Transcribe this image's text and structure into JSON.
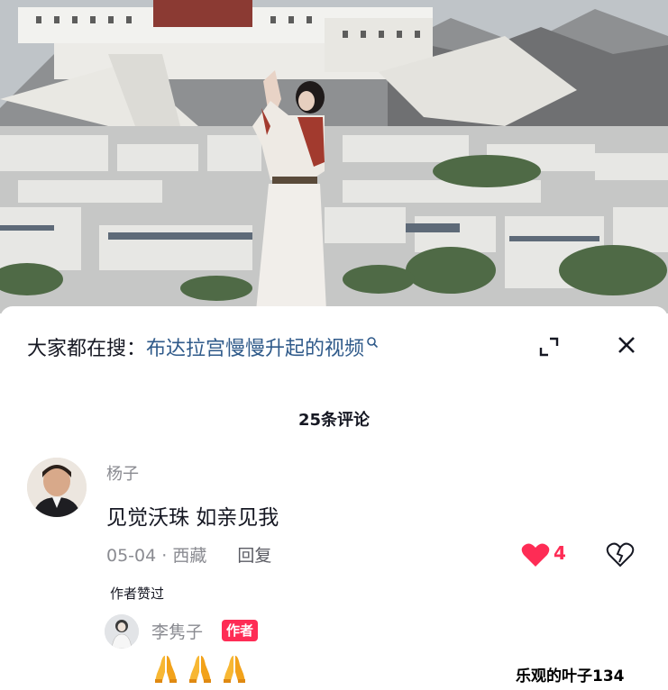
{
  "search": {
    "prefix": "大家都在搜：",
    "query": "布达拉宫慢慢升起的视频"
  },
  "comments": {
    "count_label": "25条评论",
    "top_comment": {
      "username": "杨子",
      "text": "见觉沃珠 如亲见我",
      "date_location": "05-04 · 西藏",
      "reply_label": "回复",
      "like_count": "4",
      "author_liked_label": "作者赞过"
    },
    "reply": {
      "username": "李隽子",
      "badge": "作者",
      "emoji": [
        "pray-icon",
        "pray-icon",
        "pray-icon"
      ]
    }
  },
  "watermark": "乐观的叶子134",
  "colors": {
    "accent_red": "#fe2c55",
    "link_blue": "#2f5a8a",
    "secondary_text": "#8a8b91"
  }
}
